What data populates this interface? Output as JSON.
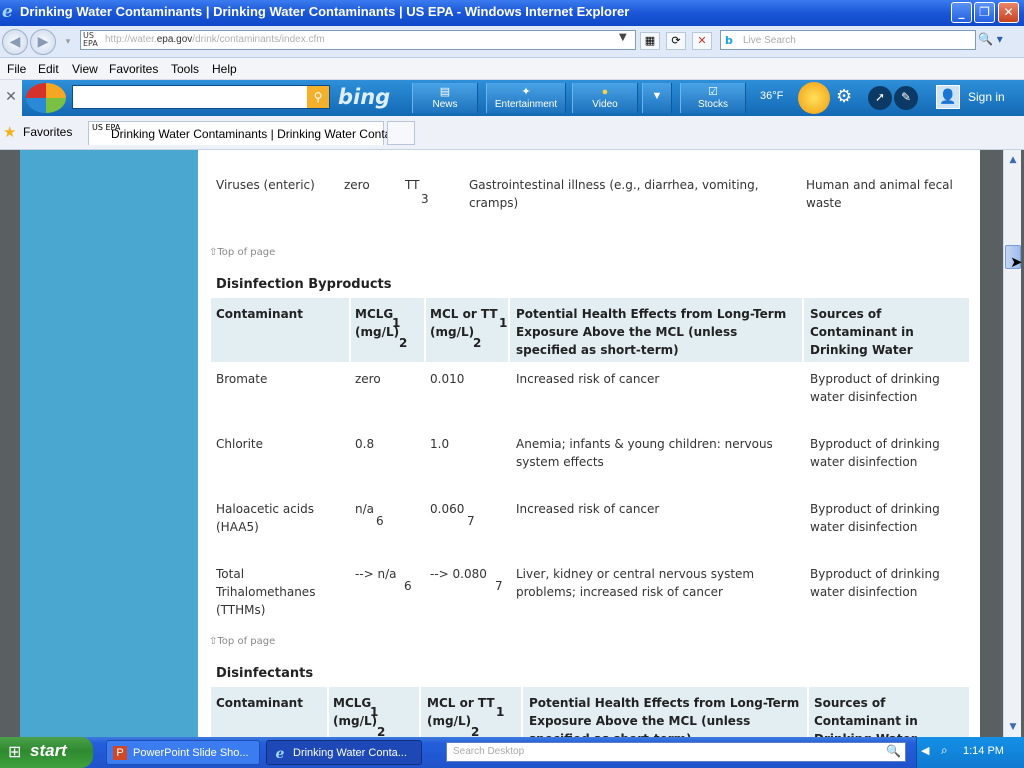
{
  "window": {
    "title": "Drinking Water Contaminants | Drinking Water Contaminants | US EPA - Windows Internet Explorer",
    "controls": {
      "minimize": "_",
      "maximize": "❐",
      "close": "✕"
    }
  },
  "address": {
    "favicon": "US EPA",
    "url_prefix": "http://water.",
    "url_domain": "epa.gov",
    "url_suffix": "/drink/contaminants/index.cfm",
    "live_search_placeholder": "Live Search"
  },
  "menu": [
    "File",
    "Edit",
    "View",
    "Favorites",
    "Tools",
    "Help"
  ],
  "bing_bar": {
    "logo": "bing",
    "buttons": [
      "News",
      "Entertainment",
      "Video",
      "Stocks"
    ],
    "temperature": "36°F",
    "sign_in": "Sign in"
  },
  "favorites_bar": {
    "label": "Favorites",
    "tab_title": "Drinking Water Contaminants | Drinking Water Conta...",
    "tab_favicon": "US EPA"
  },
  "content": {
    "virus_row": {
      "name": "Viruses (enteric)",
      "mclg": "zero",
      "mcl": "TT",
      "mcl_note": "3",
      "effects": "Gastrointestinal illness (e.g., diarrhea, vomiting, cramps)",
      "sources": "Human and animal fecal waste"
    },
    "top_of_page": "Top of page",
    "disinfection_byproducts": {
      "heading": "Disinfection Byproducts",
      "headers": {
        "contaminant": "Contaminant",
        "mclg": "MCLG",
        "mclg_unit": "(mg/L)",
        "mclg_note1": "1",
        "mclg_note2": "2",
        "mcl": "MCL or TT",
        "mcl_unit": "(mg/L)",
        "mcl_note1": "1",
        "mcl_note2": "2",
        "effects": "Potential Health Effects from Long-Term Exposure Above the MCL (unless specified as short-term)",
        "sources": "Sources of Contaminant in Drinking Water"
      },
      "rows": [
        {
          "name": "Bromate",
          "mclg": "zero",
          "mclg_note": "",
          "mcl": "0.010",
          "mcl_note": "",
          "effects": "Increased risk of cancer",
          "sources": "Byproduct of drinking water disinfection"
        },
        {
          "name": "Chlorite",
          "mclg": "0.8",
          "mclg_note": "",
          "mcl": "1.0",
          "mcl_note": "",
          "effects": "Anemia; infants & young children: nervous system effects",
          "sources": "Byproduct of drinking water disinfection"
        },
        {
          "name": "Haloacetic acids (HAA5)",
          "mclg": "n/a",
          "mclg_note": "6",
          "mcl": "0.060",
          "mcl_note": "7",
          "effects": "Increased risk of cancer",
          "sources": "Byproduct of drinking water disinfection"
        },
        {
          "name": "Total Trihalomethanes (TTHMs)",
          "mclg": "--> n/a",
          "mclg_note": "6",
          "mcl": "--> 0.080",
          "mcl_note": "7",
          "effects": "Liver, kidney or central nervous system problems; increased risk of cancer",
          "sources": "Byproduct of drinking water disinfection"
        }
      ]
    },
    "disinfectants": {
      "heading": "Disinfectants",
      "headers": {
        "contaminant": "Contaminant",
        "mclg": "MCLG",
        "mclg_unit": "(mg/L)",
        "mclg_note1": "1",
        "mclg_note2": "2",
        "mcl": "MCL or TT",
        "mcl_unit": "(mg/L)",
        "mcl_note1": "1",
        "mcl_note2": "2",
        "effects": "Potential Health Effects from Long-Term Exposure Above the MCL (unless specified as short-term)",
        "sources": "Sources of Contaminant in Drinking Water"
      }
    }
  },
  "taskbar": {
    "start": "start",
    "tasks": [
      "PowerPoint Slide Sho...",
      "Drinking Water Conta..."
    ],
    "search_placeholder": "Search Desktop",
    "clock": "1:14 PM"
  }
}
